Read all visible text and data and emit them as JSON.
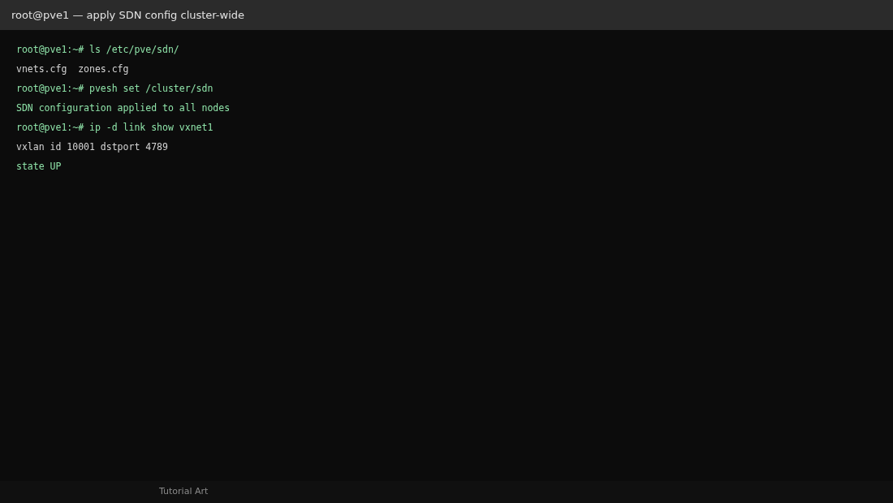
{
  "window": {
    "title": "root@pve1 — apply SDN config cluster-wide"
  },
  "terminal": {
    "lines": [
      {
        "kind": "command",
        "text": "root@pve1:~# ls /etc/pve/sdn/"
      },
      {
        "kind": "output",
        "text": "vnets.cfg  zones.cfg"
      },
      {
        "kind": "command",
        "text": "root@pve1:~# pvesh set /cluster/sdn"
      },
      {
        "kind": "success",
        "text": "SDN configuration applied to all nodes"
      },
      {
        "kind": "command",
        "text": "root@pve1:~# ip -d link show vxnet1"
      },
      {
        "kind": "output",
        "text": "vxlan id 10001 dstport 4789"
      },
      {
        "kind": "success",
        "text": "state UP"
      }
    ]
  },
  "status_bar": {
    "text": "Tutorial Art"
  }
}
